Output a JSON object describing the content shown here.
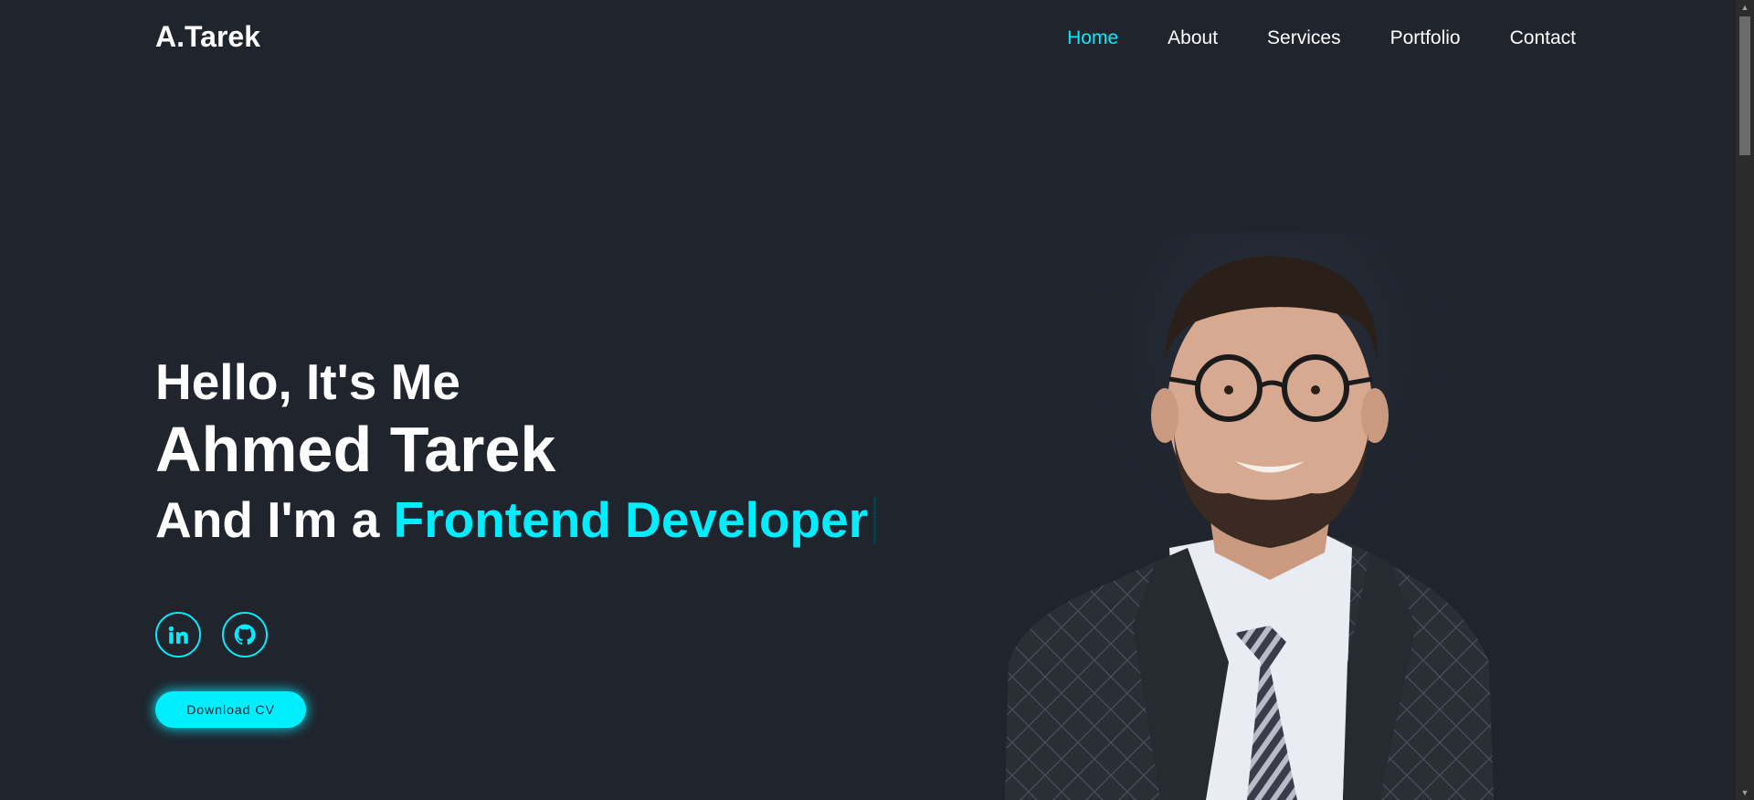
{
  "header": {
    "logo": "A.Tarek",
    "nav": [
      "Home",
      "About",
      "Services",
      "Portfolio",
      "Contact"
    ],
    "active_nav": "Home"
  },
  "hero": {
    "greeting": "Hello, It's Me",
    "name": "Ahmed Tarek",
    "role_prefix": "And I'm a ",
    "role": "Frontend Developer",
    "download_label": "Download CV"
  },
  "social": {
    "icons": [
      "linkedin-icon",
      "github-icon"
    ]
  },
  "colors": {
    "background": "#1f242d",
    "accent": "#00eeff",
    "text": "#ffffff"
  }
}
